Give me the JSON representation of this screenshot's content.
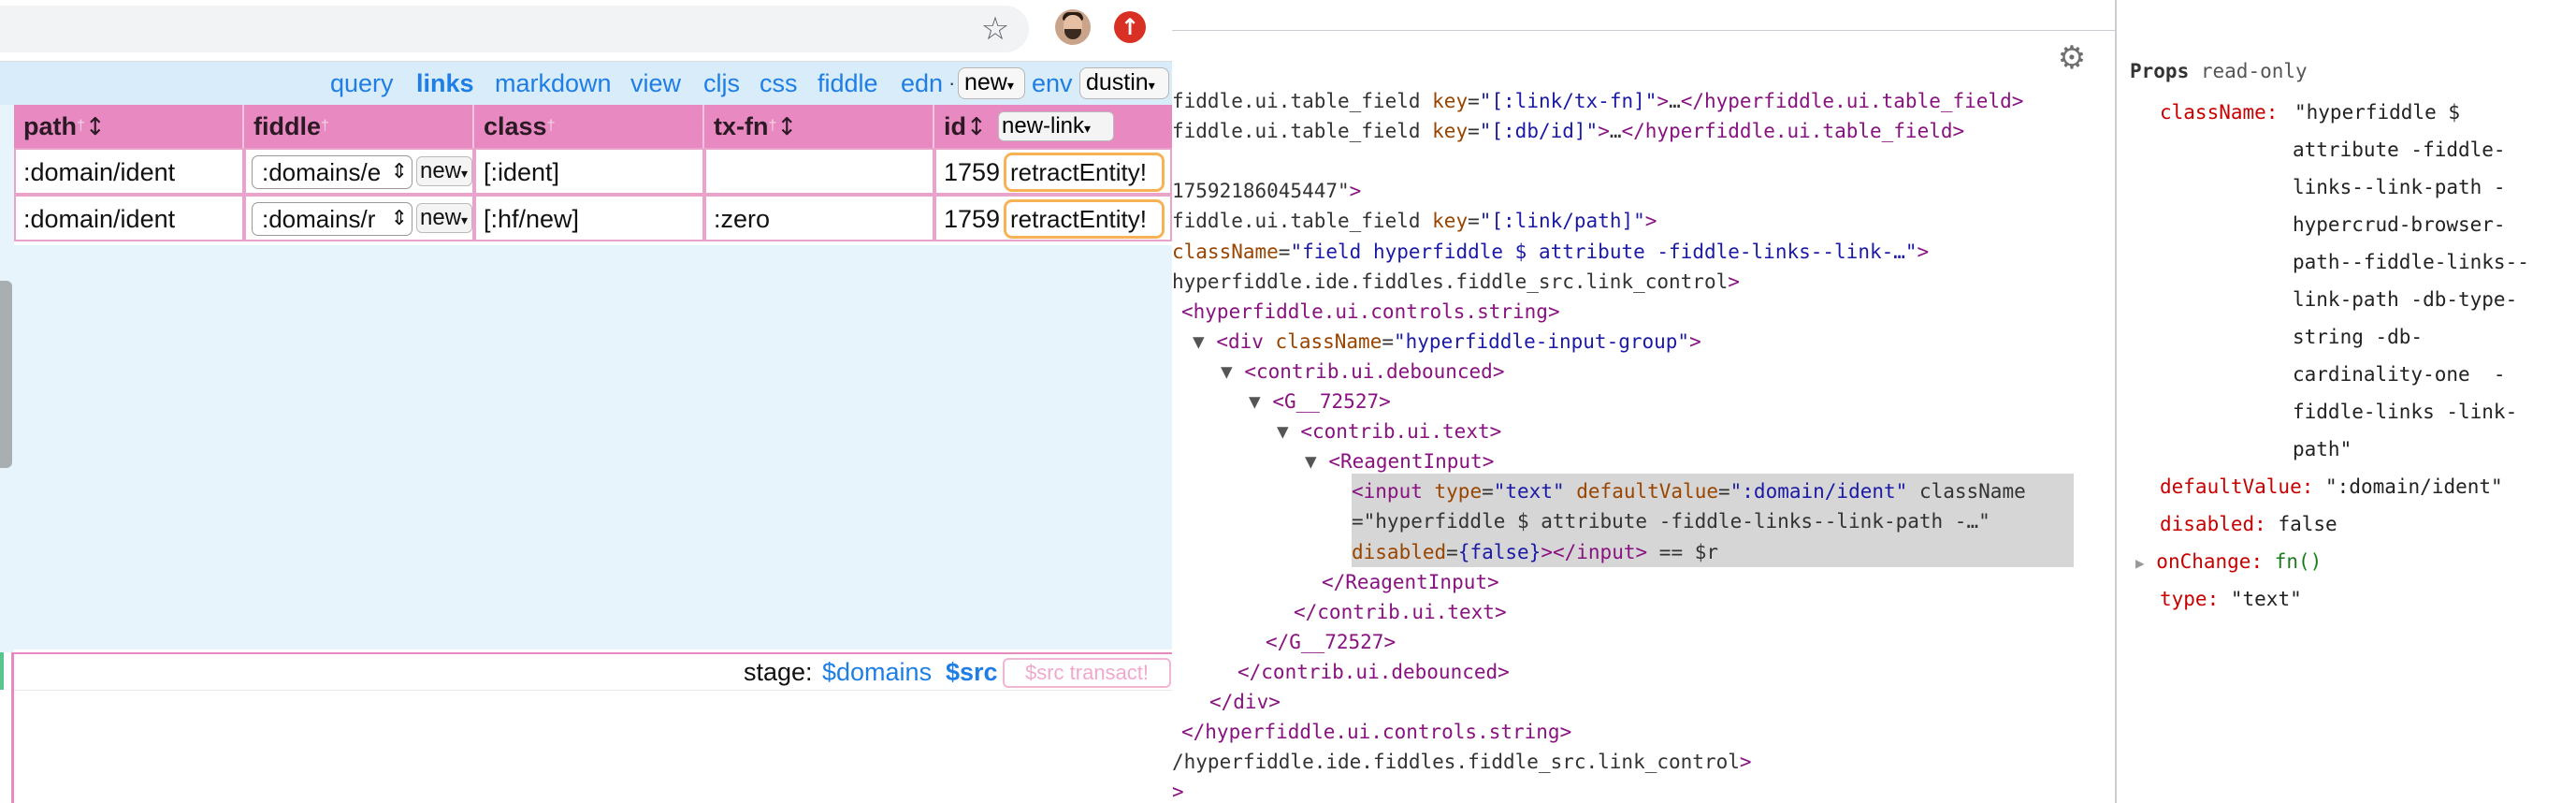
{
  "browser": {
    "star_icon": "star-icon",
    "update_icon": "update-arrow-icon"
  },
  "nav": {
    "query": "query",
    "links": "links",
    "markdown": "markdown",
    "view": "view",
    "cljs": "cljs",
    "css": "css",
    "fiddle": "fiddle",
    "edn": "edn",
    "dot": "·",
    "new_select": "new",
    "env": "env",
    "user_select": "dustin"
  },
  "table": {
    "headers": {
      "path": "path",
      "fiddle": "fiddle",
      "class": "class",
      "txfn": "tx-fn",
      "id": "id",
      "new_link": "new-link"
    },
    "sort_glyph": "↕",
    "tip_glyph": "†",
    "rows": [
      {
        "path": ":domain/ident",
        "fiddle": ":domains/e",
        "new": "new",
        "class": "[:ident]",
        "txfn": "",
        "id": "1759",
        "retract": "retractEntity!"
      },
      {
        "path": ":domain/ident",
        "fiddle": ":domains/r",
        "new": "new",
        "class": "[:hf/new]",
        "txfn": ":zero",
        "id": "1759",
        "retract": "retractEntity!"
      }
    ]
  },
  "stage": {
    "label": "stage:",
    "domains": "$domains",
    "src": "$src",
    "transact": "$src transact!"
  },
  "devtools": {
    "lines": [
      [
        "fiddle.ui.table_field key=\"[:link/tx-fn]\">…</hyperfiddle.ui.table_field>"
      ],
      [
        "fiddle.ui.table_field key=\"[:db/id]\">…</hyperfiddle.ui.table_field>"
      ],
      [
        ""
      ],
      [
        "17592186045447\">"
      ],
      [
        "fiddle.ui.table_field key=\"[:link/path]\">"
      ],
      [
        "className=\"field hyperfiddle $ attribute -fiddle-links--link-…\">"
      ],
      [
        "hyperfiddle.ide.fiddles.fiddle_src.link_control>"
      ],
      [
        "<hyperfiddle.ui.controls.string>"
      ],
      [
        "▼ <div className=\"hyperfiddle-input-group\">"
      ],
      [
        "▼ <contrib.ui.debounced>"
      ],
      [
        "▼ <G__72527>"
      ],
      [
        "▼ <contrib.ui.text>"
      ],
      [
        "▼ <ReagentInput>"
      ],
      [
        "<input type=\"text\" defaultValue=\":domain/ident\" className"
      ],
      [
        "=\"hyperfiddle $ attribute -fiddle-links--link-path -…\""
      ],
      [
        "disabled={false}></input> == $r"
      ],
      [
        "</ReagentInput>"
      ],
      [
        "</contrib.ui.text>"
      ],
      [
        "</G__72527>"
      ],
      [
        "</contrib.ui.debounced>"
      ],
      [
        "</div>"
      ],
      [
        "</hyperfiddle.ui.controls.string>"
      ],
      [
        "/hyperfiddle.ide.fiddles.fiddle_src.link_control>"
      ],
      [
        ">"
      ]
    ],
    "gear_icon": "gear-icon"
  },
  "props": {
    "title": "Props",
    "readonly": "read-only",
    "className_key": "className:",
    "className_lines": [
      "\"hyperfiddle $",
      "attribute -fiddle-",
      "links--link-path -",
      "hypercrud-browser-",
      "path--fiddle-links--",
      "link-path -db-type-",
      "string -db-",
      "cardinality-one  -",
      "fiddle-links -link-",
      "path\""
    ],
    "defaultValue_key": "defaultValue:",
    "defaultValue_val": "\":domain/ident\"",
    "disabled_key": "disabled:",
    "disabled_val": "false",
    "onChange_key": "onChange:",
    "onChange_val": "fn()",
    "type_key": "type:",
    "type_val": "\"text\""
  }
}
